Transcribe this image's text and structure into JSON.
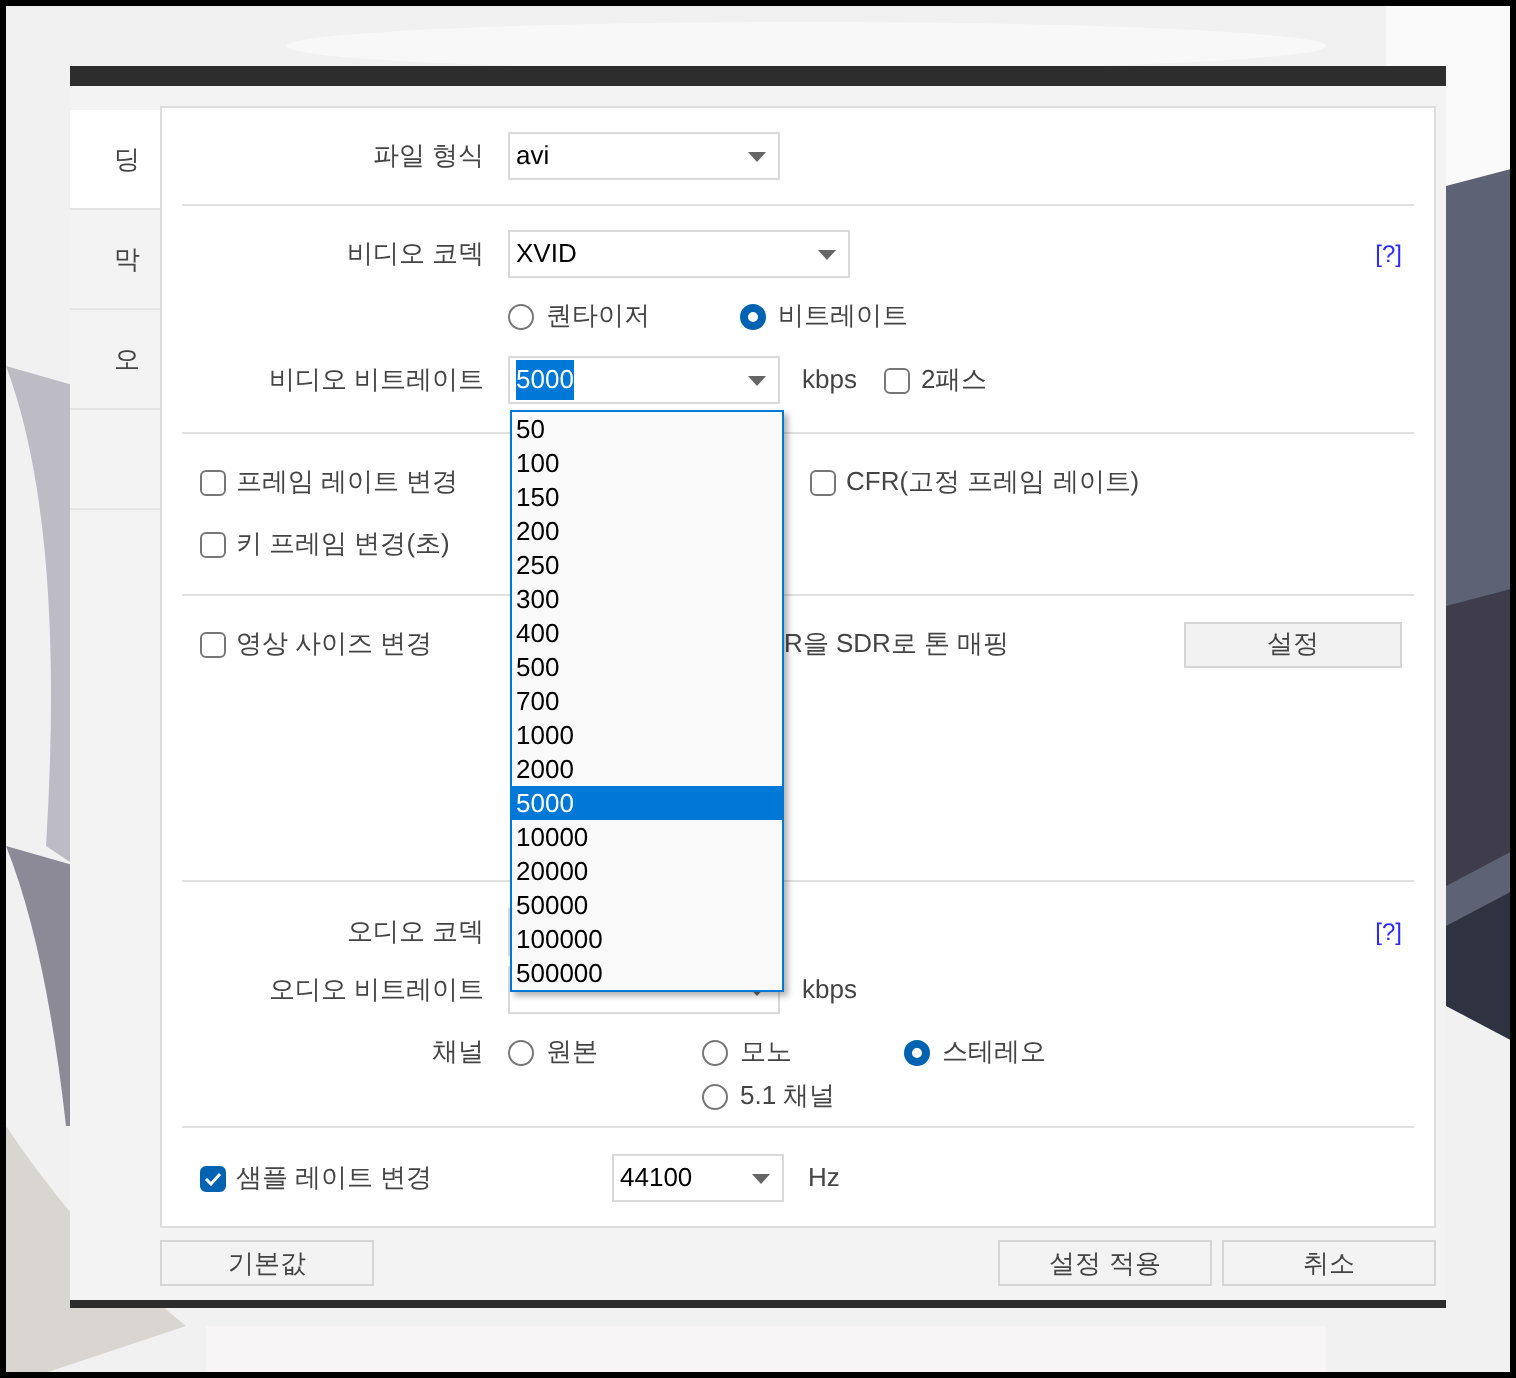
{
  "sidebar": {
    "items": [
      {
        "label": "딩",
        "selected": true
      },
      {
        "label": "막",
        "selected": false
      },
      {
        "label": "오",
        "selected": false
      },
      {
        "selected": false
      }
    ]
  },
  "file_format": {
    "label": "파일 형식",
    "value": "avi"
  },
  "video": {
    "codec": {
      "label": "비디오 코덱",
      "value": "XVID",
      "help": "[?]"
    },
    "mode_options": [
      {
        "label": "퀀타이저",
        "selected": false
      },
      {
        "label": "비트레이트",
        "selected": true
      }
    ],
    "bitrate": {
      "label": "비디오 비트레이트",
      "value": "5000",
      "unit": "kbps",
      "expanded": true,
      "options": [
        {
          "label": "50",
          "selected": false
        },
        {
          "label": "100",
          "selected": false
        },
        {
          "label": "150",
          "selected": false
        },
        {
          "label": "200",
          "selected": false
        },
        {
          "label": "250",
          "selected": false
        },
        {
          "label": "300",
          "selected": false
        },
        {
          "label": "400",
          "selected": false
        },
        {
          "label": "500",
          "selected": false
        },
        {
          "label": "700",
          "selected": false
        },
        {
          "label": "1000",
          "selected": false
        },
        {
          "label": "2000",
          "selected": false
        },
        {
          "label": "5000",
          "selected": true
        },
        {
          "label": "10000",
          "selected": false
        },
        {
          "label": "20000",
          "selected": false
        },
        {
          "label": "50000",
          "selected": false
        },
        {
          "label": "100000",
          "selected": false
        },
        {
          "label": "500000",
          "selected": false
        }
      ]
    },
    "two_pass": {
      "label": "2패스",
      "checked": false
    }
  },
  "frame": {
    "frame_rate": {
      "label": "프레임 레이트 변경",
      "checked": false
    },
    "cfr": {
      "label": "CFR(고정 프레임 레이트)",
      "checked": false
    },
    "keyframe": {
      "label": "키 프레임 변경(초)",
      "checked": false
    }
  },
  "size": {
    "resize": {
      "label": "영상 사이즈 변경",
      "checked": false
    },
    "tone_mapping": {
      "label": "R을 SDR로 톤 매핑"
    },
    "settings_button": "설정"
  },
  "audio": {
    "codec_label": "오디오 코덱",
    "help": "[?]",
    "bitrate": {
      "label": "오디오 비트레이트",
      "unit": "kbps"
    },
    "channel_label": "채널",
    "channels": [
      {
        "label": "원본",
        "selected": false
      },
      {
        "label": "모노",
        "selected": false
      },
      {
        "label": "스테레오",
        "selected": true
      },
      {
        "label": "5.1 채널",
        "selected": false
      }
    ],
    "sample_rate": {
      "label": "샘플 레이트 변경",
      "checked": true,
      "value": "44100",
      "unit": "Hz"
    }
  },
  "buttons": [
    {
      "label": "기본값"
    },
    {
      "label": "설정 적용"
    },
    {
      "label": "취소"
    }
  ]
}
